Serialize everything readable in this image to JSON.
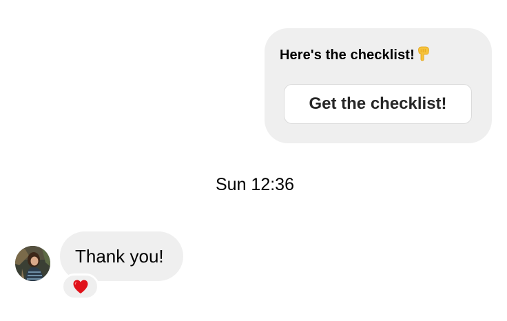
{
  "outgoing_message": {
    "text": "Here's the checklist!",
    "emoji_icon": "backhand-index-pointing-down-icon",
    "button_label": "Get the checklist!"
  },
  "timestamp": "Sun 12:36",
  "incoming_message": {
    "text": "Thank you!",
    "reaction_icon": "red-heart-icon"
  },
  "colors": {
    "bubble": "#efefef",
    "button_border": "#dbdbdb",
    "heart": "#e0121a"
  }
}
